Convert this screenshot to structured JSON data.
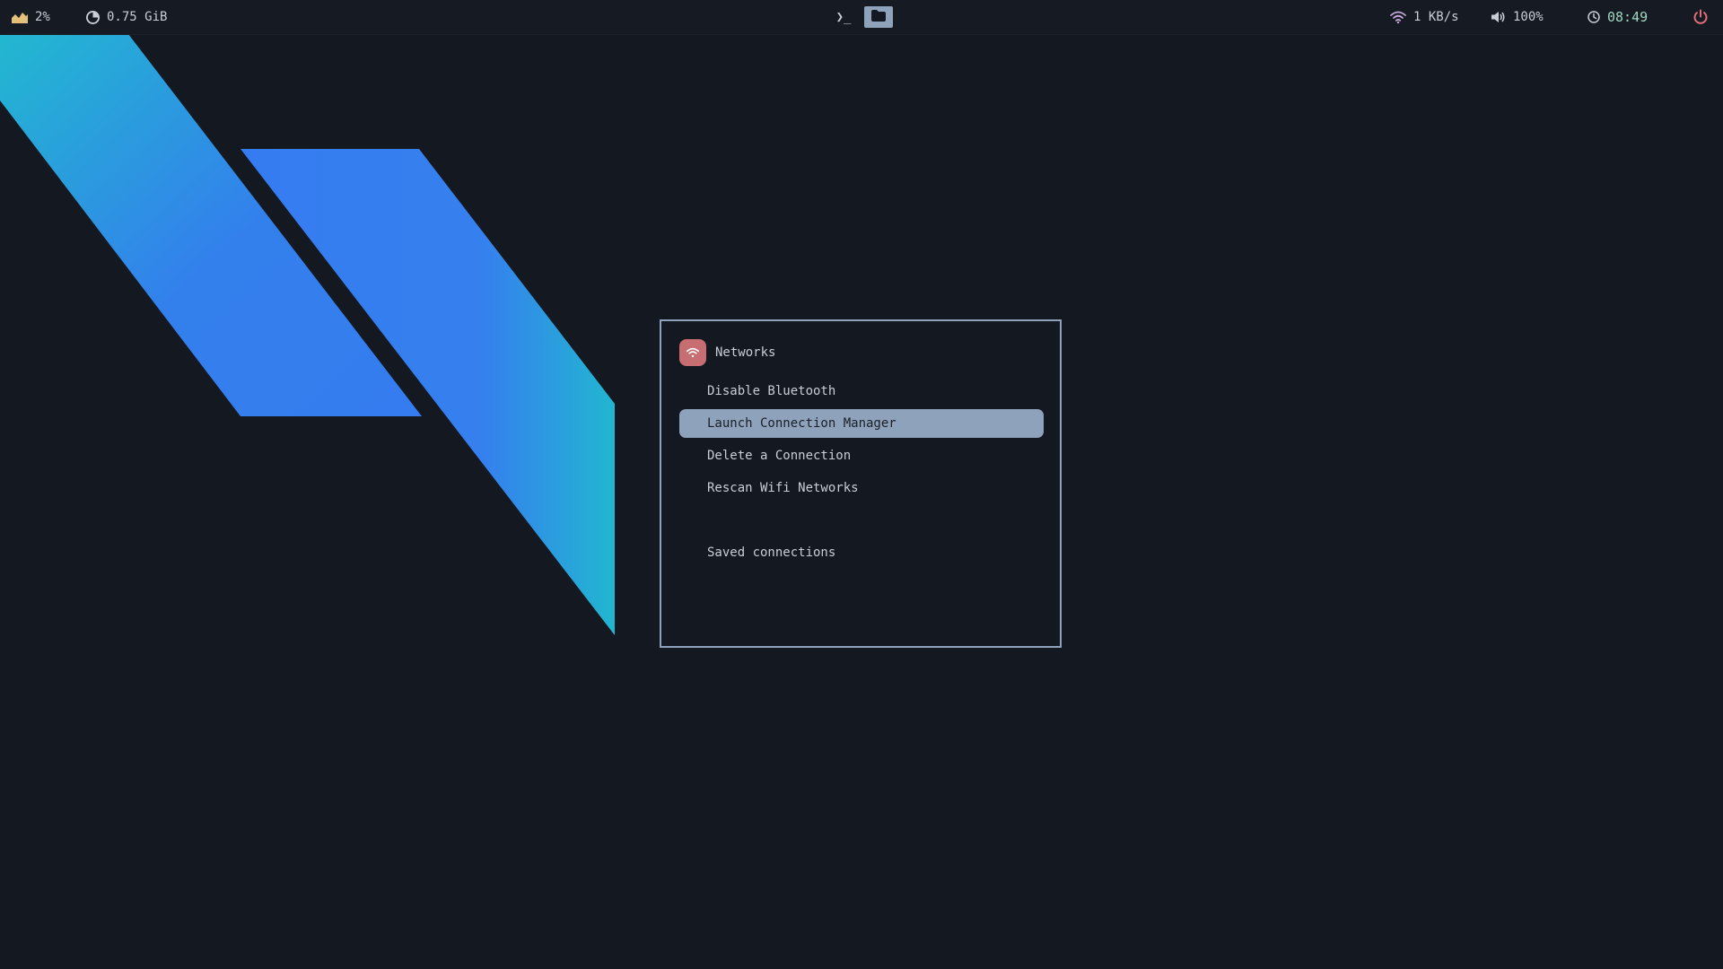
{
  "topbar": {
    "cpu": {
      "icon": "cpu-chart-icon",
      "value": "2%"
    },
    "memory": {
      "icon": "memory-pie-icon",
      "value": "0.75 GiB"
    },
    "workspaces": [
      {
        "icon": "terminal-icon",
        "glyph": "❯_",
        "active": false
      },
      {
        "icon": "folder-icon",
        "active": true
      }
    ],
    "network": {
      "icon": "wifi-icon",
      "value": "1 KB/s"
    },
    "volume": {
      "icon": "volume-icon",
      "value": "100%"
    },
    "clock": {
      "icon": "clock-icon",
      "value": "08:49"
    },
    "power": {
      "icon": "power-icon"
    }
  },
  "menu": {
    "prompt": {
      "icon": "wifi-icon",
      "label": "Networks"
    },
    "entries": [
      {
        "label": "Disable Bluetooth",
        "selected": false
      },
      {
        "label": "Launch Connection Manager",
        "selected": true
      },
      {
        "label": "Delete a Connection",
        "selected": false
      },
      {
        "label": "Rescan Wifi Networks",
        "selected": false
      },
      {
        "label": "",
        "selected": false
      },
      {
        "label": "Saved connections",
        "selected": false
      }
    ]
  },
  "colors": {
    "background": "#141820",
    "accent": "#8ea2bb",
    "prompt_icon_bg": "#c76e72",
    "clock": "#9fd8c0",
    "power": "#e06c75",
    "wallpaper_cyan": "#22b6d2",
    "wallpaper_blue": "#357cf0"
  }
}
